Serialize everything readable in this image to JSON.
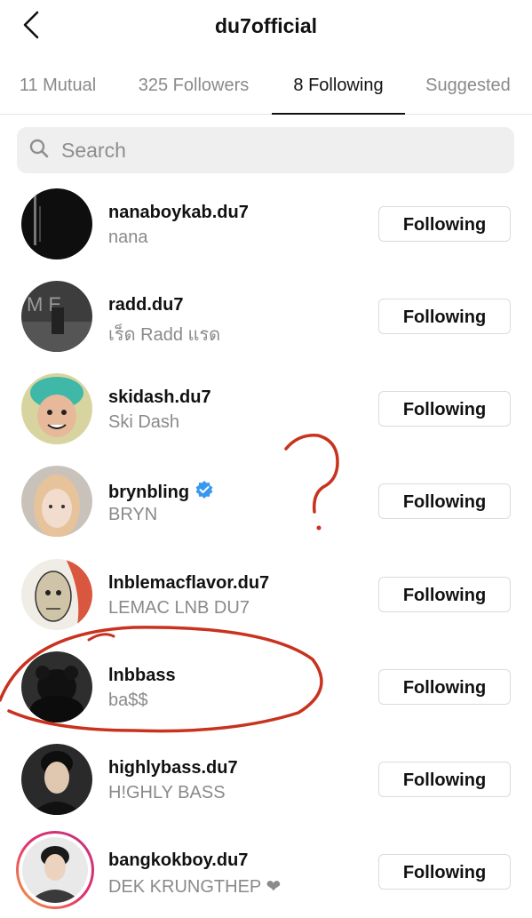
{
  "header": {
    "title": "du7official",
    "back_icon": "chevron-left-icon"
  },
  "tabs": [
    {
      "label": "11 Mutual",
      "active": false
    },
    {
      "label": "325 Followers",
      "active": false
    },
    {
      "label": "8 Following",
      "active": true
    },
    {
      "label": "Suggested",
      "active": false
    }
  ],
  "search": {
    "placeholder": "Search",
    "value": "",
    "icon": "search-icon"
  },
  "following": [
    {
      "username": "nanaboykab.du7",
      "name": "nana",
      "button": "Following",
      "verified": false
    },
    {
      "username": "radd.du7",
      "name": "เร็ด Radd แรด",
      "button": "Following",
      "verified": false
    },
    {
      "username": "skidash.du7",
      "name": "Ski Dash",
      "button": "Following",
      "verified": false
    },
    {
      "username": "brynbling",
      "name": "BRYN",
      "button": "Following",
      "verified": true
    },
    {
      "username": "lnblemacflavor.du7",
      "name": "LEMAC LNB DU7",
      "button": "Following",
      "verified": false
    },
    {
      "username": "lnbbass",
      "name": "ba$$",
      "button": "Following",
      "verified": false
    },
    {
      "username": "highlybass.du7",
      "name": "H!GHLY BASS",
      "button": "Following",
      "verified": false
    },
    {
      "username": "bangkokboy.du7",
      "name": "DEK KRUNGTHEP ❤",
      "button": "Following",
      "verified": false,
      "story_ring": true
    }
  ],
  "annotations": {
    "question_mark": "?",
    "color": "#c8321e"
  },
  "colors": {
    "verified_blue": "#3897f0",
    "muted_text": "#8a8a8a",
    "search_bg": "#efefef"
  }
}
